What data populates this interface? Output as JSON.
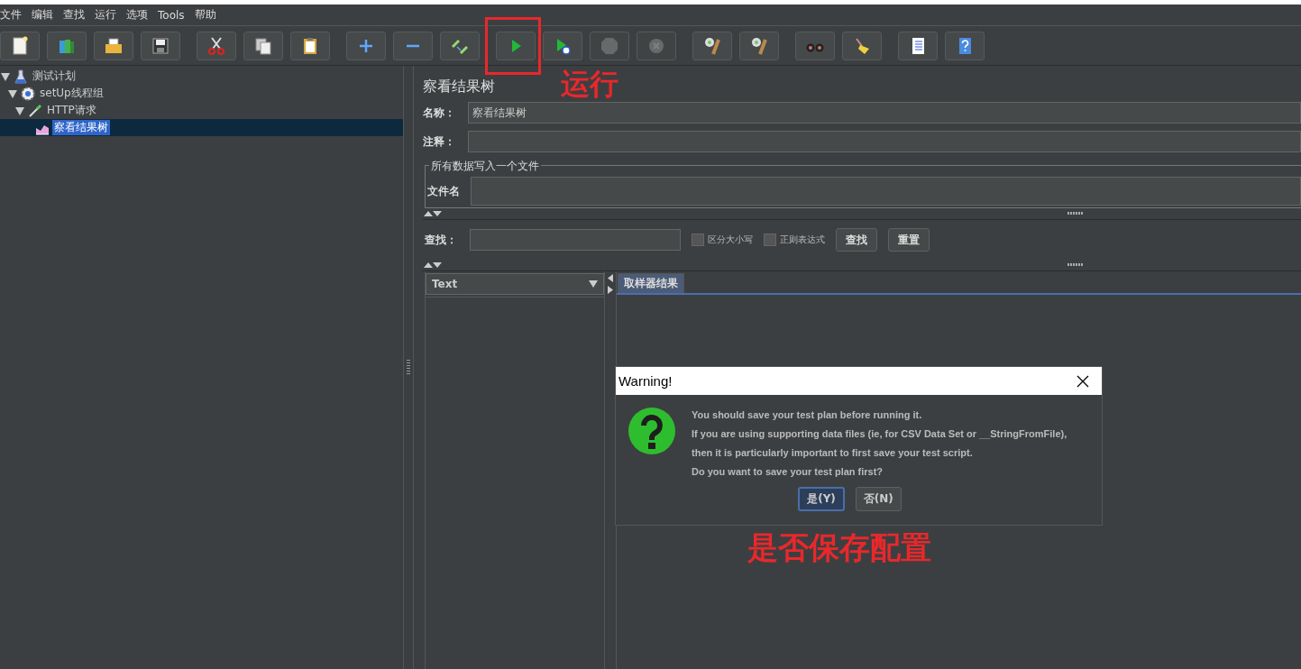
{
  "menu": [
    "文件",
    "编辑",
    "查找",
    "运行",
    "选项",
    "Tools",
    "帮助"
  ],
  "toolbar": [
    {
      "kind": "new",
      "disabled": false
    },
    {
      "kind": "templates",
      "disabled": false
    },
    {
      "kind": "open",
      "disabled": false
    },
    {
      "kind": "save",
      "disabled": false
    },
    {
      "kind": "cut",
      "disabled": false
    },
    {
      "kind": "copy",
      "disabled": false
    },
    {
      "kind": "paste",
      "disabled": false
    },
    {
      "kind": "expand",
      "disabled": false
    },
    {
      "kind": "collapse",
      "disabled": false
    },
    {
      "kind": "toggle",
      "disabled": false
    },
    {
      "kind": "start",
      "disabled": false
    },
    {
      "kind": "start-no-pause",
      "disabled": false
    },
    {
      "kind": "stop",
      "disabled": true
    },
    {
      "kind": "shutdown",
      "disabled": true
    },
    {
      "kind": "clear",
      "disabled": false
    },
    {
      "kind": "clear-all",
      "disabled": false
    },
    {
      "kind": "search",
      "disabled": false
    },
    {
      "kind": "reset",
      "disabled": false
    },
    {
      "kind": "functions",
      "disabled": false
    },
    {
      "kind": "help",
      "disabled": false
    }
  ],
  "tree": [
    {
      "label": "测试计划",
      "kind": "plan",
      "expanded": true,
      "selected": false,
      "children": [
        {
          "label": "setUp线程组",
          "kind": "group",
          "expanded": true,
          "selected": false,
          "children": [
            {
              "label": "HTTP请求",
              "kind": "sampler",
              "expanded": true,
              "selected": false,
              "children": [
                {
                  "label": "察看结果树",
                  "kind": "listener",
                  "selected": true
                }
              ]
            }
          ]
        }
      ]
    }
  ],
  "panel": {
    "title": "察看结果树",
    "name_label": "名称：",
    "name_value": "察看结果树",
    "comment_label": "注释：",
    "file_group": "所有数据写入一个文件",
    "file_label": "文件名",
    "search_label": "查找：",
    "case_checkbox": {
      "label": "区分大小写",
      "checked": false
    },
    "regex_checkbox": {
      "label": "正则表达式",
      "checked": false
    },
    "search_button": "查找",
    "reset_button": "重置",
    "renderer": "Text",
    "tabs": [
      {
        "label": "取样器结果",
        "selected": true
      }
    ]
  },
  "dialog": {
    "title": "Warning!",
    "lines": [
      "You should save your test plan before running it.",
      "If you are using supporting data files (ie, for CSV Data Set or __StringFromFile),",
      "then it is particularly important to first save your test script.",
      "Do you want to save your test plan first?"
    ],
    "buttons": [
      {
        "label": "是(Y)",
        "selected": true
      },
      {
        "label": "否(N)",
        "selected": false
      }
    ]
  },
  "annotations": [
    {
      "text": "运行"
    },
    {
      "text": "是否保存配置"
    }
  ]
}
